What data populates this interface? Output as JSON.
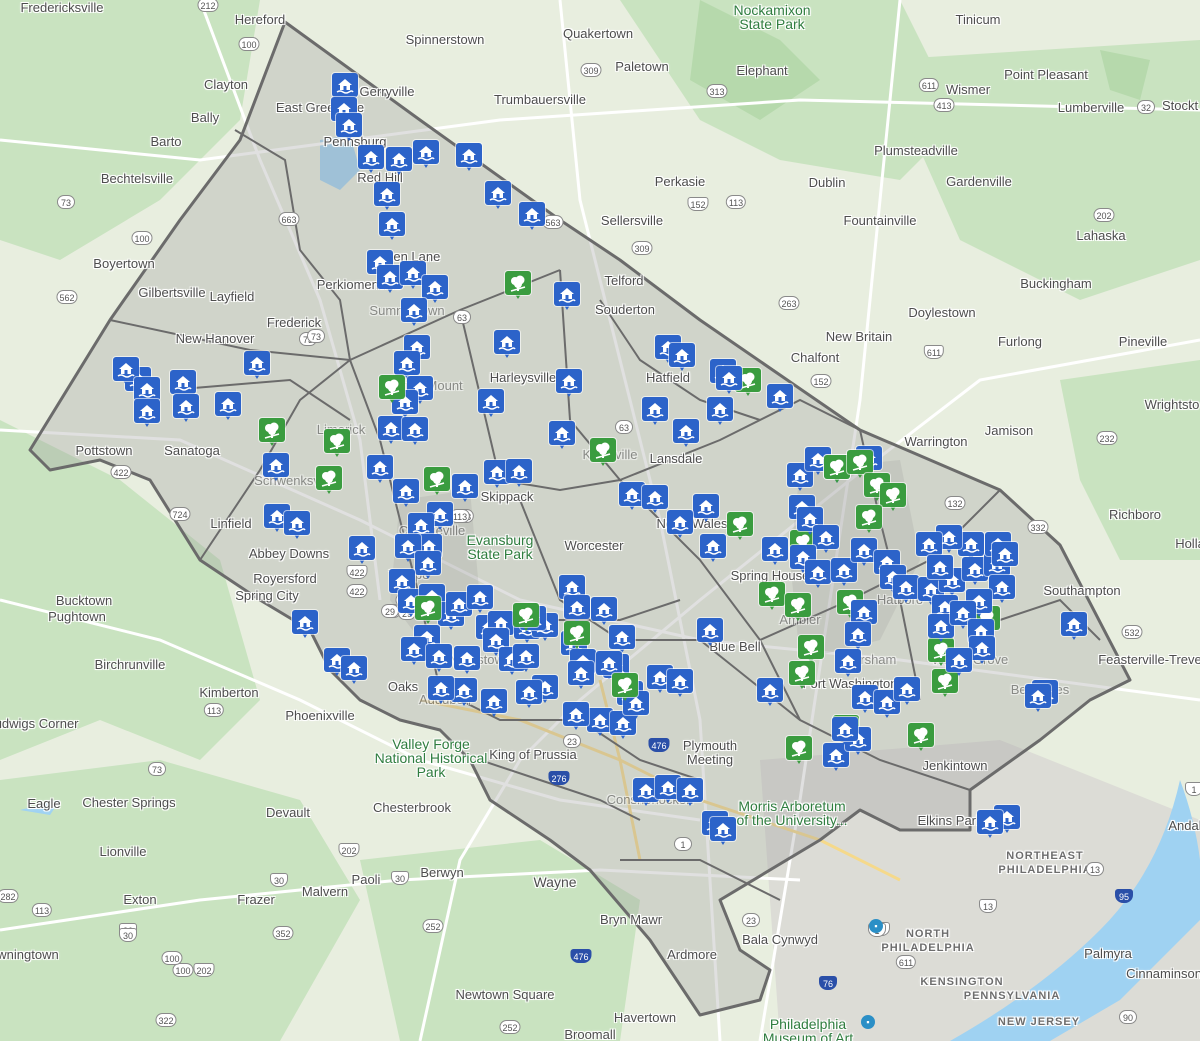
{
  "map": {
    "colors": {
      "land": "#e8eedf",
      "forest": "#c9e3c0",
      "water": "#9fd2f2",
      "county_fill": "#9e9e9e",
      "county_border": "#6b6b6b",
      "road": "#ffffff",
      "flood_marker": "#2c63c9",
      "tree_marker": "#3a9c3f",
      "poi": "#2b8fc6"
    },
    "marker_types": {
      "flood": "flooded-house-icon",
      "tree": "fallen-tree-icon"
    },
    "places": [
      {
        "text": "Fredericksville"
      },
      {
        "text": "Hereford"
      },
      {
        "text": "Spinnerstown"
      },
      {
        "text": "Quakertown"
      },
      {
        "text": "Nockamixon State Park"
      },
      {
        "text": "Tinicum"
      },
      {
        "text": "Clayton"
      },
      {
        "text": "Paletown"
      },
      {
        "text": "Elephant"
      },
      {
        "text": "Point Pleasant"
      },
      {
        "text": "Wismer"
      },
      {
        "text": "Bally"
      },
      {
        "text": "Trumbauersville"
      },
      {
        "text": "Lumberville"
      },
      {
        "text": "Stockt"
      },
      {
        "text": "Barto"
      },
      {
        "text": "Plumsteadville"
      },
      {
        "text": "Bechtelsville"
      },
      {
        "text": "Perkasie"
      },
      {
        "text": "Dublin"
      },
      {
        "text": "Gardenville"
      },
      {
        "text": "Sellersville"
      },
      {
        "text": "Fountainville"
      },
      {
        "text": "Boyertown"
      },
      {
        "text": "Lahaska"
      },
      {
        "text": "Buckingham"
      },
      {
        "text": "Gilbertsville"
      },
      {
        "text": "Layfield"
      },
      {
        "text": "Telford"
      },
      {
        "text": "Souderton"
      },
      {
        "text": "Doylestown"
      },
      {
        "text": "Frederick"
      },
      {
        "text": "New Hanover"
      },
      {
        "text": "New Britain"
      },
      {
        "text": "Furlong"
      },
      {
        "text": "Pineville"
      },
      {
        "text": "Chalfont"
      },
      {
        "text": "Harleysville"
      },
      {
        "text": "Hatfield"
      },
      {
        "text": "Wrightsto"
      },
      {
        "text": "Warrington"
      },
      {
        "text": "Jamison"
      },
      {
        "text": "Pottstown"
      },
      {
        "text": "Sanatoga"
      },
      {
        "text": "Lansdale"
      },
      {
        "text": "Skippack"
      },
      {
        "text": "Richboro"
      },
      {
        "text": "Linfield"
      },
      {
        "text": "North Wales"
      },
      {
        "text": "Evansburg State Park"
      },
      {
        "text": "Worcester"
      },
      {
        "text": "Abbey Downs"
      },
      {
        "text": "Royersford"
      },
      {
        "text": "Spring City"
      },
      {
        "text": "Holla"
      },
      {
        "text": "Bucktown"
      },
      {
        "text": "Pughtown"
      },
      {
        "text": "Southampton"
      },
      {
        "text": "Spring House"
      },
      {
        "text": "Feasterville-Treve"
      },
      {
        "text": "Blue Bell"
      },
      {
        "text": "Birchrunville"
      },
      {
        "text": "Kimberton"
      },
      {
        "text": "Phoenixville"
      },
      {
        "text": "Oaks"
      },
      {
        "text": "Fort Washington"
      },
      {
        "text": "Ludwigs Corner"
      },
      {
        "text": "King of Prussia"
      },
      {
        "text": "Plymouth Meeting"
      },
      {
        "text": "Valley Forge National Historical Park"
      },
      {
        "text": "Jenkintown"
      },
      {
        "text": "Chester Springs"
      },
      {
        "text": "Morris Arboretum of the University..."
      },
      {
        "text": "Eagle"
      },
      {
        "text": "Devault"
      },
      {
        "text": "Chesterbrook"
      },
      {
        "text": "Elkins Park"
      },
      {
        "text": "Andal"
      },
      {
        "text": "Lionville"
      },
      {
        "text": "NORTHEAST PHILADELPHIA"
      },
      {
        "text": "Malvern"
      },
      {
        "text": "Paoli"
      },
      {
        "text": "Berwyn"
      },
      {
        "text": "Exton"
      },
      {
        "text": "Frazer"
      },
      {
        "text": "Wayne"
      },
      {
        "text": "Bryn Mawr"
      },
      {
        "text": "Bala Cynwyd"
      },
      {
        "text": "NORTH PHILADELPHIA"
      },
      {
        "text": "Palmyra"
      },
      {
        "text": "wningtown"
      },
      {
        "text": "Ardmore"
      },
      {
        "text": "KENSINGTON"
      },
      {
        "text": "Cinnaminson"
      },
      {
        "text": "PENNSYLVANIA"
      },
      {
        "text": "NEW JERSEY"
      },
      {
        "text": "Newtown Square"
      },
      {
        "text": "Havertown"
      },
      {
        "text": "Broomall"
      },
      {
        "text": "Philadelphia Museum of Art"
      },
      {
        "text": "Gerryville"
      },
      {
        "text": "East Greenville"
      },
      {
        "text": "Pennsburg"
      },
      {
        "text": "Red Hill"
      },
      {
        "text": "Green Lane"
      },
      {
        "text": "Perkiomenville"
      },
      {
        "text": "Sumneytown"
      },
      {
        "text": "Schwenksville"
      },
      {
        "text": "Limerick"
      },
      {
        "text": "Spring Mount"
      },
      {
        "text": "Kulpsville"
      },
      {
        "text": "Collegeville"
      },
      {
        "text": "Trappe"
      },
      {
        "text": "Audubon"
      },
      {
        "text": "Norristown"
      },
      {
        "text": "Ambler"
      },
      {
        "text": "Horsham"
      },
      {
        "text": "Hatboro"
      },
      {
        "text": "Willow Grove"
      },
      {
        "text": "Bethayres"
      },
      {
        "text": "Conshohocken"
      }
    ],
    "routes": [
      "212",
      "100",
      "309",
      "611",
      "413",
      "32",
      "313",
      "73",
      "563",
      "113",
      "663",
      "152",
      "263",
      "202",
      "100",
      "562",
      "63",
      "309",
      "152",
      "63",
      "232",
      "611",
      "422",
      "724",
      "113",
      "29",
      "422",
      "363",
      "73",
      "332",
      "132",
      "532",
      "29",
      "113",
      "23",
      "476",
      "73",
      "1",
      "13",
      "276",
      "76",
      "202",
      "30",
      "30",
      "352",
      "30",
      "100",
      "202",
      "252",
      "476",
      "23",
      "1",
      "13",
      "95",
      "611",
      "322",
      "252",
      "1",
      "90",
      "282",
      "113",
      "30",
      "100",
      "1",
      "422",
      "29",
      "113",
      "73"
    ]
  }
}
